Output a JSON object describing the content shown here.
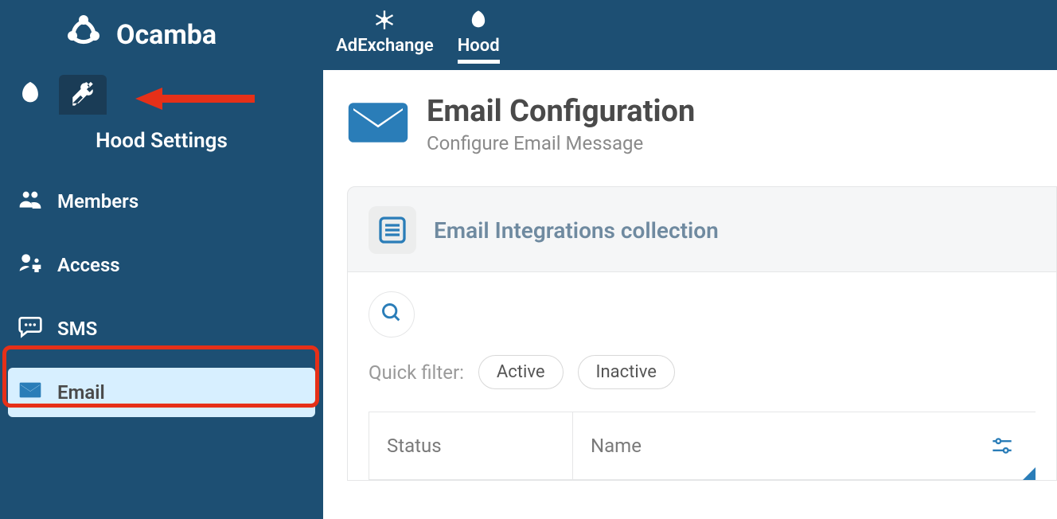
{
  "brand": {
    "name": "Ocamba"
  },
  "topnav": {
    "items": [
      {
        "label": "AdExchange",
        "active": false
      },
      {
        "label": "Hood",
        "active": true
      }
    ]
  },
  "sidebar": {
    "title": "Hood Settings",
    "items": [
      {
        "key": "members",
        "label": "Members"
      },
      {
        "key": "access",
        "label": "Access"
      },
      {
        "key": "sms",
        "label": "SMS"
      },
      {
        "key": "email",
        "label": "Email",
        "selected": true
      }
    ]
  },
  "page": {
    "title": "Email Configuration",
    "subtitle": "Configure Email Message"
  },
  "panel": {
    "title": "Email Integrations collection",
    "quick_filter_label": "Quick filter:",
    "filters": [
      {
        "label": "Active"
      },
      {
        "label": "Inactive"
      }
    ],
    "columns": {
      "status": "Status",
      "name": "Name"
    }
  }
}
